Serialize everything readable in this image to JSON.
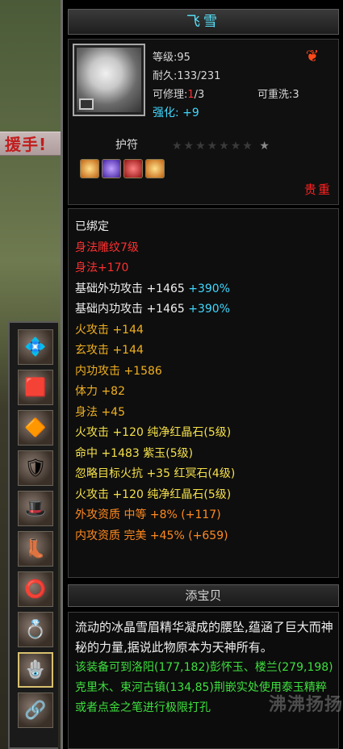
{
  "banner_text": "援手!",
  "item": {
    "name": "飞雪",
    "level": "等级:95",
    "durability": "耐久:133/231",
    "repair_prefix": "可修理:",
    "repair_current": "1",
    "repair_total": "/3",
    "rewash": "可重洗:3",
    "enhance_label": "强化:",
    "enhance_value": "+9",
    "type": "护符",
    "stars_dim": "★★★★★★★",
    "star_last": "★",
    "quality": "贵重"
  },
  "attributes": {
    "bound": "已绑定",
    "engrave": "身法雕纹7级",
    "engrave_bonus": "身法+170",
    "ext_atk": "基础外功攻击 +1465",
    "ext_atk_pct": "+390%",
    "int_atk": "基础内功攻击 +1465",
    "int_atk_pct": "+390%",
    "l1": "火攻击 +144",
    "l2": "玄攻击 +144",
    "l3": "内功攻击 +1586",
    "l4": "体力 +82",
    "l5": "身法 +45",
    "g1": "火攻击 +120 纯净红晶石(5级)",
    "g2": "命中 +1483 紫玉(5级)",
    "g3": "忽略目标火抗 +35 红冥石(4级)",
    "g4": "火攻击 +120 纯净红晶石(5级)",
    "apt1": "外攻资质   中等 +8% (+117)",
    "apt2": "内攻资质   完美 +45% (+659)"
  },
  "treasure_label": "添宝贝",
  "description": {
    "text": "流动的冰晶雪眉精华凝成的腰坠,蕴涵了巨大而神秘的力量,据说此物原本为天神所有。",
    "source": "该装备可到洛阳(177,182)彭怀玉、楼兰(279,198)克里木、束河古镇(134,85)荆嵌实处使用泰玉精粹或者点金之笔进行极限打孔"
  },
  "watermark": "沸沸扬扬",
  "colors": {
    "title": "#58e6ff",
    "quality_red": "#ff2020",
    "engrave_red": "#ff3030",
    "orange_stat": "#f0b020",
    "gem_yellow": "#f4e04a",
    "aptitude": "#ff8a20",
    "percent_cyan": "#40d8ff",
    "source_green": "#3ee03e"
  },
  "icons": {
    "slots": [
      "jewel-icon",
      "ring-icon",
      "bracer-icon",
      "armor-icon",
      "hat-icon",
      "boots-icon",
      "belt-icon",
      "bangle-icon",
      "amulet-icon",
      "pendant-icon"
    ],
    "class": "flame-emblem-icon"
  }
}
